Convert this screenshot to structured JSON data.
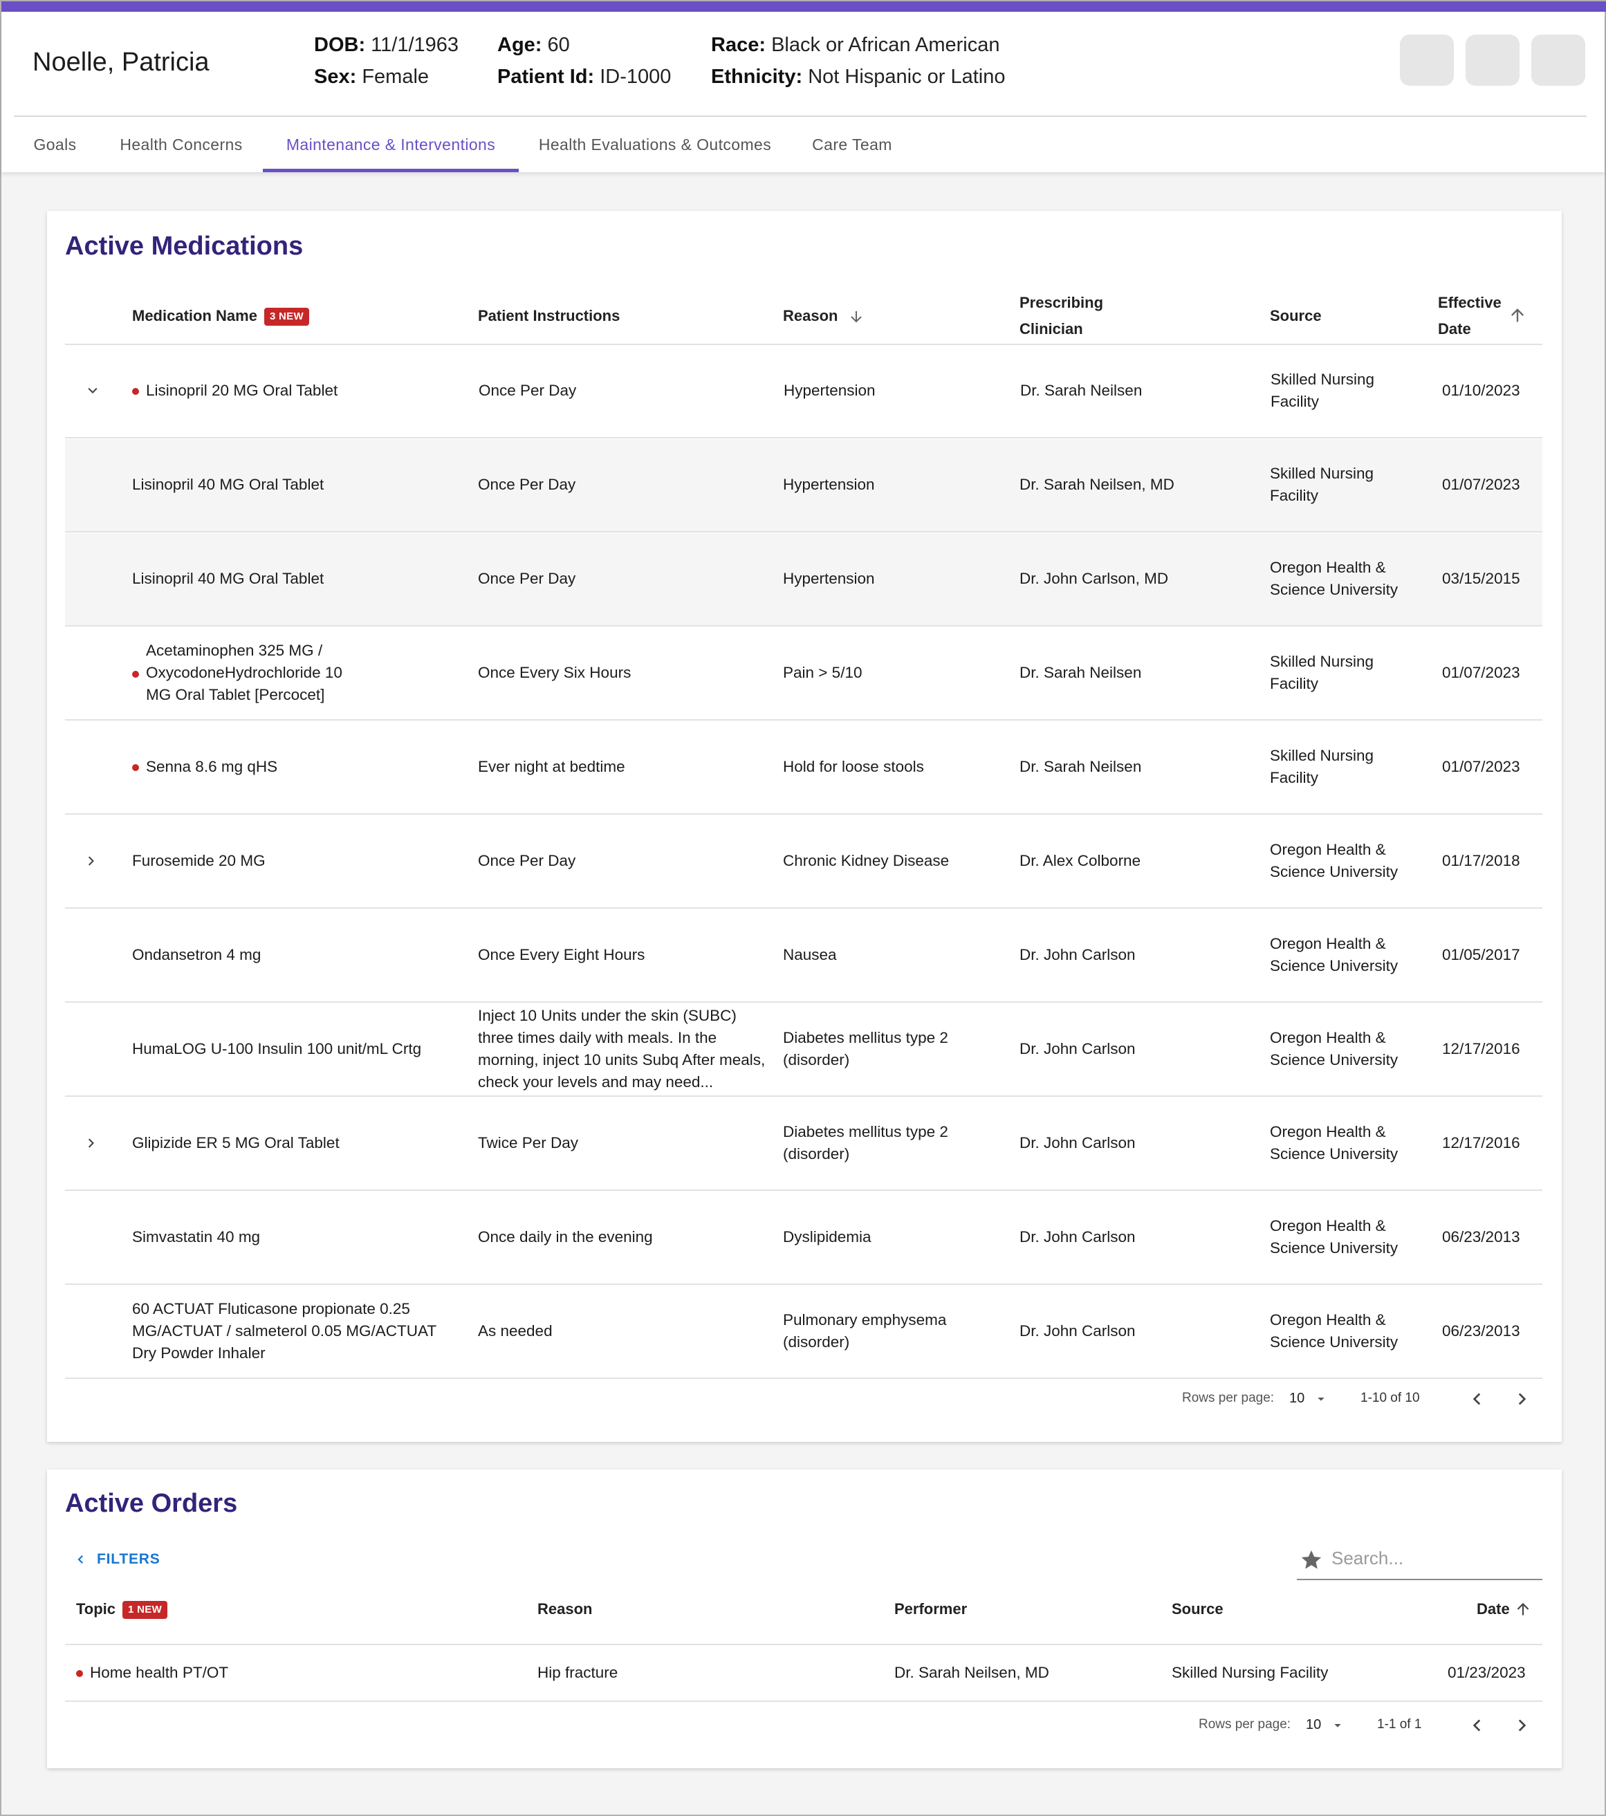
{
  "patient": {
    "name": "Noelle, Patricia",
    "dob_label": "DOB:",
    "dob": "11/1/1963",
    "sex_label": "Sex:",
    "sex": "Female",
    "age_label": "Age:",
    "age": "60",
    "pid_label": "Patient Id:",
    "pid": "ID-1000",
    "race_label": "Race:",
    "race": "Black or African American",
    "eth_label": "Ethnicity:",
    "ethnicity": "Not Hispanic or Latino"
  },
  "tabs": [
    {
      "label": "Goals"
    },
    {
      "label": "Health Concerns"
    },
    {
      "label": "Maintenance & Interventions"
    },
    {
      "label": "Health Evaluations & Outcomes"
    },
    {
      "label": "Care Team"
    }
  ],
  "medications": {
    "title": "Active Medications",
    "headers": {
      "name": "Medication Name",
      "badge": "3 NEW",
      "instructions": "Patient Instructions",
      "reason": "Reason",
      "clinician_1": "Prescribing",
      "clinician_2": "Clinician",
      "source": "Source",
      "date_1": "Effective",
      "date_2": "Date"
    },
    "rows": [
      {
        "name": "Lisinopril 20 MG Oral Tablet",
        "instr": "Once Per Day",
        "reason": "Hypertension",
        "clin": "Dr. Sarah Neilsen",
        "source": "Skilled Nursing Facility",
        "date": "01/10/2023"
      },
      {
        "name": "Lisinopril 40 MG Oral Tablet",
        "instr": "Once Per Day",
        "reason": "Hypertension",
        "clin": "Dr. Sarah Neilsen, MD",
        "source": "Skilled Nursing Facility",
        "date": "01/07/2023"
      },
      {
        "name": "Lisinopril 40 MG Oral Tablet",
        "instr": "Once Per Day",
        "reason": "Hypertension",
        "clin": "Dr. John Carlson, MD",
        "source": "Oregon Health & Science University",
        "date": "03/15/2015"
      },
      {
        "name": "Acetaminophen 325 MG / OxycodoneHydrochloride 10 MG Oral Tablet [Percocet]",
        "instr": "Once Every Six Hours",
        "reason": "Pain > 5/10",
        "clin": "Dr. Sarah Neilsen",
        "source": "Skilled Nursing Facility",
        "date": "01/07/2023"
      },
      {
        "name": "Senna 8.6 mg qHS",
        "instr": "Ever night at bedtime",
        "reason": "Hold for loose stools",
        "clin": "Dr. Sarah Neilsen",
        "source": "Skilled Nursing Facility",
        "date": "01/07/2023"
      },
      {
        "name": "Furosemide 20 MG",
        "instr": "Once Per Day",
        "reason": "Chronic Kidney Disease",
        "clin": "Dr. Alex Colborne",
        "source": "Oregon Health & Science University",
        "date": "01/17/2018"
      },
      {
        "name": "Ondansetron 4 mg",
        "instr": "Once Every Eight Hours",
        "reason": "Nausea",
        "clin": "Dr. John Carlson",
        "source": "Oregon Health & Science University",
        "date": "01/05/2017"
      },
      {
        "name": "HumaLOG U-100 Insulin 100 unit/mL Crtg",
        "instr": "Inject 10 Units under the skin (SUBC) three times daily with meals. In the morning, inject 10 units Subq After meals, check your levels and may need...",
        "reason": "Diabetes mellitus type 2 (disorder)",
        "clin": "Dr. John Carlson",
        "source": "Oregon Health & Science University",
        "date": "12/17/2016"
      },
      {
        "name": "Glipizide ER 5 MG Oral Tablet",
        "instr": "Twice Per Day",
        "reason": "Diabetes mellitus type 2 (disorder)",
        "clin": "Dr. John Carlson",
        "source": "Oregon Health & Science University",
        "date": "12/17/2016"
      },
      {
        "name": "Simvastatin 40 mg",
        "instr": "Once daily in the evening",
        "reason": "Dyslipidemia",
        "clin": "Dr. John Carlson",
        "source": "Oregon Health & Science University",
        "date": "06/23/2013"
      },
      {
        "name": "60 ACTUAT Fluticasone propionate 0.25 MG/ACTUAT / salmeterol 0.05 MG/ACTUAT Dry Powder Inhaler",
        "instr": "As needed",
        "reason": "Pulmonary emphysema (disorder)",
        "clin": "Dr. John Carlson",
        "source": "Oregon Health & Science University",
        "date": "06/23/2013"
      }
    ],
    "pager": {
      "rows_label": "Rows per page:",
      "rows_value": "10",
      "range": "1-10 of 10"
    }
  },
  "orders": {
    "title": "Active Orders",
    "filters_label": "FILTERS",
    "search_placeholder": "Search...",
    "headers": {
      "topic": "Topic",
      "badge": "1 NEW",
      "reason": "Reason",
      "performer": "Performer",
      "source": "Source",
      "date": "Date"
    },
    "rows": [
      {
        "topic": "Home health PT/OT",
        "reason": "Hip fracture",
        "performer": "Dr. Sarah Neilsen, MD",
        "source": "Skilled Nursing Facility",
        "date": "01/23/2023"
      }
    ],
    "pager": {
      "rows_label": "Rows per page:",
      "rows_value": "10",
      "range": "1-1 of 1"
    }
  },
  "colors": {
    "accent": "#6a4fc6",
    "title": "#33237a",
    "new_badge": "#c62828",
    "link": "#1976d2"
  }
}
